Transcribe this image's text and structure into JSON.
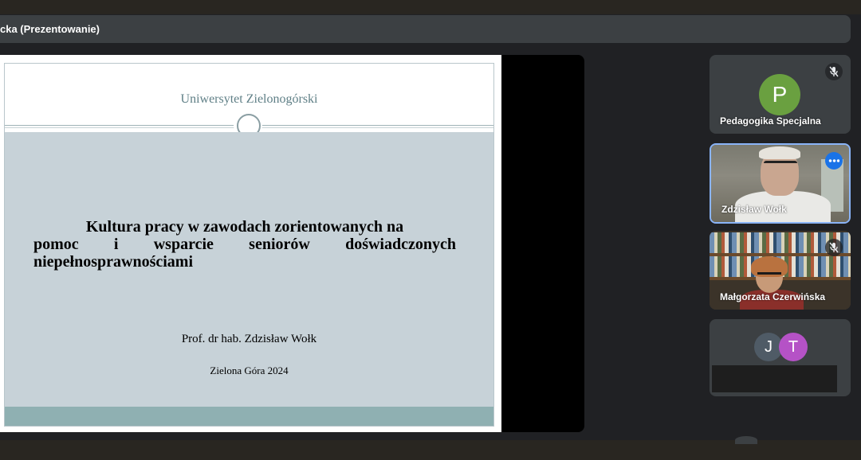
{
  "presenter": {
    "label": "cka (Prezentowanie)"
  },
  "slide": {
    "university": "Uniwersytet Zielonogórski",
    "title_lines": [
      "Kultura pracy w zawodach zorientowanych na",
      "pomoc i wsparcie seniorów doświadczonych",
      "niepełnosprawnościami"
    ],
    "author": "Prof. dr hab. Zdzisław Wołk",
    "place_date": "Zielona Góra 2024"
  },
  "participants": [
    {
      "name": "Pedagogika Specjalna",
      "initial": "P",
      "muted": true,
      "avatar_color": "#6aa040"
    },
    {
      "name": "Zdzisław Wołk",
      "active_speaker": true,
      "more_icon": "more-horiz-icon"
    },
    {
      "name": "Małgorzata Czerwińska",
      "muted": true
    },
    {
      "initials": [
        "J",
        "T"
      ],
      "avatar_colors": [
        "#4f5b66",
        "#b552c6"
      ]
    }
  ],
  "colors": {
    "background": "#202124",
    "tile": "#3c4043",
    "active_border": "#8ab4f8",
    "badge_blue": "#1a73e8"
  }
}
